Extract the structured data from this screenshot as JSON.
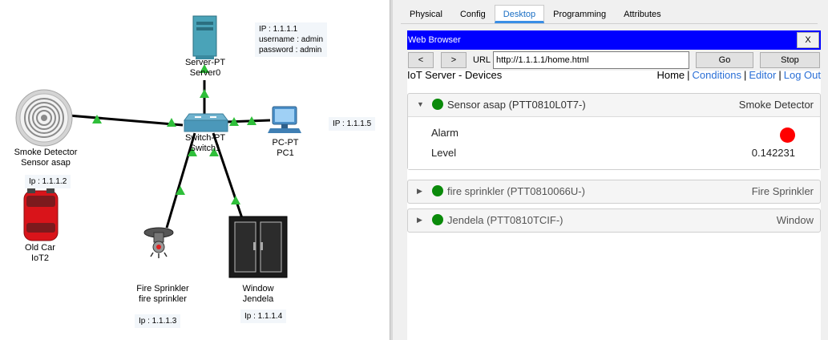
{
  "topology": {
    "server": {
      "type": "Server-PT",
      "name": "Server0"
    },
    "server_note": [
      "IP : 1.1.1.1",
      "username  : admin",
      "password : admin"
    ],
    "switch": {
      "type": "Switch-PT",
      "name": "Switch1"
    },
    "pc": {
      "type": "PC-PT",
      "name": "PC1"
    },
    "pc_ip": "IP : 1.1.1.5",
    "smoke": {
      "type": "Smoke Detector",
      "name": "Sensor asap"
    },
    "smoke_ip": "Ip : 1.1.1.2",
    "car": {
      "type": "Old Car",
      "name": "IoT2"
    },
    "sprinkler": {
      "type": "Fire Sprinkler",
      "name": "fire sprinkler"
    },
    "sprinkler_ip": "Ip : 1.1.1.3",
    "window": {
      "type": "Window",
      "name": "Jendela"
    },
    "window_ip": "Ip : 1.1.1.4"
  },
  "tabs": [
    "Physical",
    "Config",
    "Desktop",
    "Programming",
    "Attributes"
  ],
  "active_tab": "Desktop",
  "browser": {
    "title": "Web Browser",
    "close_label": "X",
    "back_label": "<",
    "forward_label": ">",
    "url_label": "URL",
    "url": "http://1.1.1.1/home.html",
    "go_label": "Go",
    "stop_label": "Stop"
  },
  "page": {
    "title": "IoT Server - Devices",
    "nav": [
      "Home",
      "Conditions",
      "Editor",
      "Log Out"
    ]
  },
  "devices": [
    {
      "name": "Sensor asap (PTT0810L0T7-)",
      "type": "Smoke Detector",
      "expanded": true,
      "props": [
        {
          "label": "Alarm",
          "value": "",
          "indicator_color": "#ff0000"
        },
        {
          "label": "Level",
          "value": "0.142231"
        }
      ]
    },
    {
      "name": "fire sprinkler (PTT0810066U-)",
      "type": "Fire Sprinkler",
      "expanded": false
    },
    {
      "name": "Jendela (PTT0810TCIF-)",
      "type": "Window",
      "expanded": false
    }
  ],
  "colors": {
    "status_ok": "#0a8a0a",
    "link": "#2a6fd6",
    "titlebar": "#0000ff",
    "alarm": "#ff0000"
  }
}
